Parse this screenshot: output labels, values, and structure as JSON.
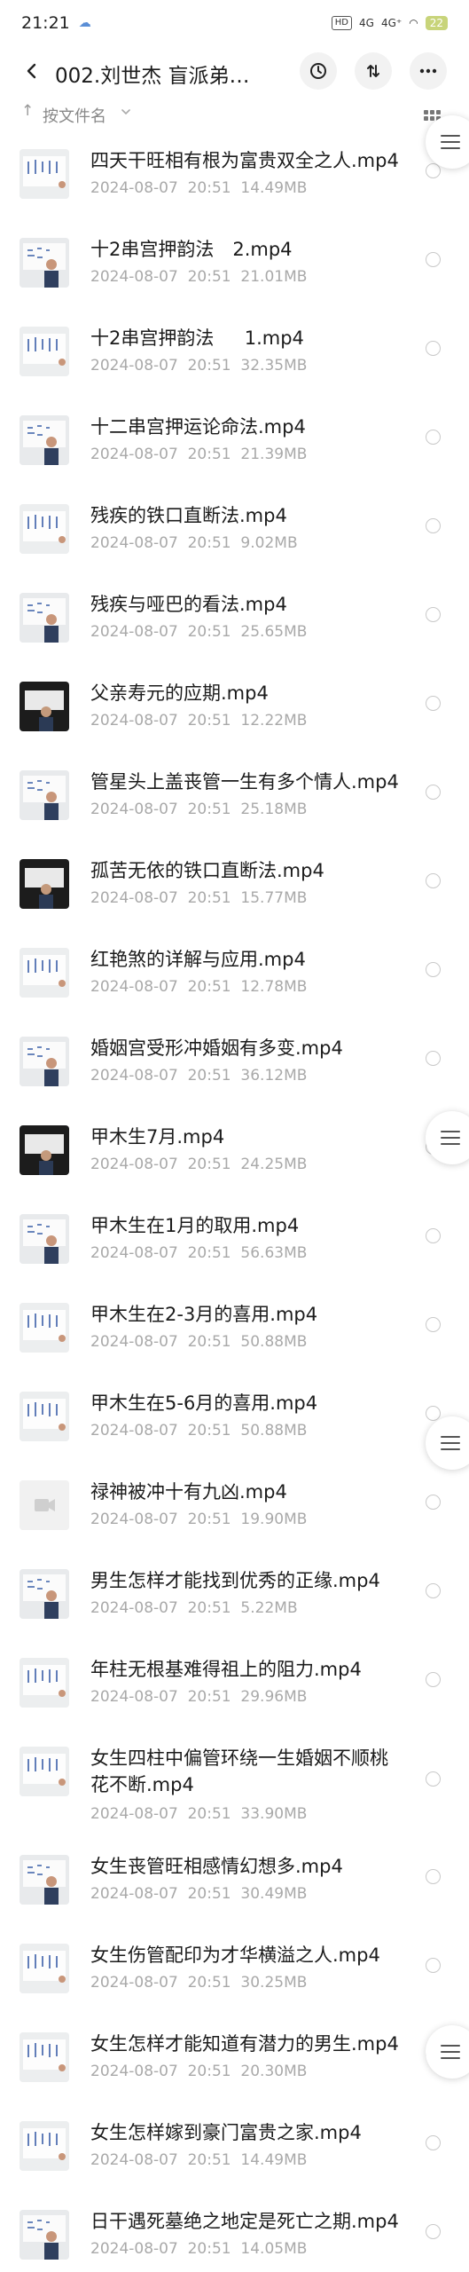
{
  "status_bar": {
    "time": "21:21",
    "cloud_icon": "cloud-sync-icon",
    "hd_label": "HD",
    "net1": "4G",
    "net2": "4G⁺",
    "battery": "22"
  },
  "header": {
    "title": "002.刘世杰 盲派弟…",
    "back_icon": "back-arrow-icon",
    "history_icon": "history-icon",
    "sort_icon": "sort-updown-icon",
    "more_icon": "more-dots-icon"
  },
  "sort_bar": {
    "arrow": "↑",
    "label": "按文件名",
    "view_icon": "grid-view-icon"
  },
  "files": [
    {
      "name": "四天干旺相有根为富贵双全之人.mp4",
      "date": "2024-08-07",
      "time": "20:51",
      "size": "14.49MB",
      "thumb": "whiteboard"
    },
    {
      "name": "十2串宫押韵法　2.mp4",
      "date": "2024-08-07",
      "time": "20:51",
      "size": "21.01MB",
      "thumb": "person-board"
    },
    {
      "name": "十2串宫押韵法　  1.mp4",
      "date": "2024-08-07",
      "time": "20:51",
      "size": "32.35MB",
      "thumb": "whiteboard"
    },
    {
      "name": "十二串宫押运论命法.mp4",
      "date": "2024-08-07",
      "time": "20:51",
      "size": "21.39MB",
      "thumb": "person-board"
    },
    {
      "name": "残疾的铁口直断法.mp4",
      "date": "2024-08-07",
      "time": "20:51",
      "size": "9.02MB",
      "thumb": "whiteboard"
    },
    {
      "name": "残疾与哑巴的看法.mp4",
      "date": "2024-08-07",
      "time": "20:51",
      "size": "25.65MB",
      "thumb": "person-board"
    },
    {
      "name": "父亲寿元的应期.mp4",
      "date": "2024-08-07",
      "time": "20:51",
      "size": "12.22MB",
      "thumb": "dark"
    },
    {
      "name": "管星头上盖丧管一生有多个情人.mp4",
      "date": "2024-08-07",
      "time": "20:51",
      "size": "25.18MB",
      "thumb": "person-board"
    },
    {
      "name": "孤苦无依的铁口直断法.mp4",
      "date": "2024-08-07",
      "time": "20:51",
      "size": "15.77MB",
      "thumb": "dark"
    },
    {
      "name": "红艳煞的详解与应用.mp4",
      "date": "2024-08-07",
      "time": "20:51",
      "size": "12.78MB",
      "thumb": "whiteboard"
    },
    {
      "name": "婚姻宫受形冲婚姻有多变.mp4",
      "date": "2024-08-07",
      "time": "20:51",
      "size": "36.12MB",
      "thumb": "person-board"
    },
    {
      "name": "甲木生7月.mp4",
      "date": "2024-08-07",
      "time": "20:51",
      "size": "24.25MB",
      "thumb": "dark"
    },
    {
      "name": "甲木生在1月的取用.mp4",
      "date": "2024-08-07",
      "time": "20:51",
      "size": "56.63MB",
      "thumb": "person-board"
    },
    {
      "name": "甲木生在2-3月的喜用.mp4",
      "date": "2024-08-07",
      "time": "20:51",
      "size": "50.88MB",
      "thumb": "whiteboard"
    },
    {
      "name": "甲木生在5-6月的喜用.mp4",
      "date": "2024-08-07",
      "time": "20:51",
      "size": "50.88MB",
      "thumb": "whiteboard"
    },
    {
      "name": "禄神被冲十有九凶.mp4",
      "date": "2024-08-07",
      "time": "20:51",
      "size": "19.90MB",
      "thumb": "video-placeholder"
    },
    {
      "name": "男生怎样才能找到优秀的正缘.mp4",
      "date": "2024-08-07",
      "time": "20:51",
      "size": "5.22MB",
      "thumb": "person-board"
    },
    {
      "name": "年柱无根基难得祖上的阻力.mp4",
      "date": "2024-08-07",
      "time": "20:51",
      "size": "29.96MB",
      "thumb": "whiteboard"
    },
    {
      "name": "女生四柱中偏管环绕一生婚姻不顺桃花不断.mp4",
      "date": "2024-08-07",
      "time": "20:51",
      "size": "33.90MB",
      "thumb": "whiteboard"
    },
    {
      "name": "女生丧管旺相感情幻想多.mp4",
      "date": "2024-08-07",
      "time": "20:51",
      "size": "30.49MB",
      "thumb": "person-board"
    },
    {
      "name": "女生伤管配印为才华横溢之人.mp4",
      "date": "2024-08-07",
      "time": "20:51",
      "size": "30.25MB",
      "thumb": "whiteboard"
    },
    {
      "name": "女生怎样才能知道有潜力的男生.mp4",
      "date": "2024-08-07",
      "time": "20:51",
      "size": "20.30MB",
      "thumb": "whiteboard"
    },
    {
      "name": "女生怎样嫁到豪门富贵之家.mp4",
      "date": "2024-08-07",
      "time": "20:51",
      "size": "14.49MB",
      "thumb": "whiteboard"
    },
    {
      "name": "日干遇死墓绝之地定是死亡之期.mp4",
      "date": "2024-08-07",
      "time": "20:51",
      "size": "14.05MB",
      "thumb": "person-board"
    }
  ],
  "side_handles": [
    {
      "icon": "drawer-handle-icon"
    },
    {
      "icon": "drawer-handle-icon"
    },
    {
      "icon": "drawer-handle-icon"
    },
    {
      "icon": "drawer-handle-icon"
    }
  ]
}
